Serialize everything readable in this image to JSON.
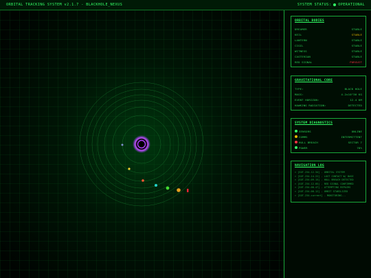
{
  "header": {
    "title": "ORBITAL TRACKING SYSTEM v2.1.7 - BLACKHOLE_NEXUS",
    "status_label": "SYSTEM STATUS:",
    "status_value": "OPERATIONAL"
  },
  "colors": {
    "accent": "#33ff66",
    "warn": "#e6b800",
    "alert": "#ff3344",
    "core": "#b040ff"
  },
  "orbital_bodies": {
    "title": "ORBITAL BODIES",
    "items": [
      {
        "name": "DREAMER",
        "status": "STABLE",
        "level": "ok"
      },
      {
        "name": "KEIL",
        "status": "STABLE",
        "level": "warn"
      },
      {
        "name": "LANTERN",
        "status": "STABLE",
        "level": "ok"
      },
      {
        "name": "CIGIL",
        "status": "STABLE",
        "level": "ok"
      },
      {
        "name": "WITNESS",
        "status": "STABLE",
        "level": "ok"
      },
      {
        "name": "CASTERIAN",
        "status": "STABLE",
        "level": "ok"
      },
      {
        "name": "RED SIGNAL",
        "status": "PURSUIT",
        "level": "bad"
      }
    ]
  },
  "gravitational_core": {
    "title": "GRAVITATIONAL CORE",
    "rows": [
      {
        "label": "TYPE:",
        "value": "BLACK HOLE"
      },
      {
        "label": "MASS:",
        "value": "4.2x10^36 KG"
      },
      {
        "label": "EVENT HORIZON:",
        "value": "12.4 KM"
      },
      {
        "label": "HAWKING RADIATION:",
        "value": "DETECTED"
      }
    ]
  },
  "system_diagnostics": {
    "title": "SYSTEM DIAGNOSTICS",
    "rows": [
      {
        "label": "SENSORS",
        "value": "ONLINE",
        "color": "#33ff66"
      },
      {
        "label": "COMMS",
        "value": "INTERMITTENT",
        "color": "#e6b800"
      },
      {
        "label": "HULL BREACH",
        "value": "SECTOR 7",
        "color": "#ff3344"
      },
      {
        "label": "POWER",
        "value": "78%",
        "color": "#33ff66"
      }
    ]
  },
  "navigation_log": {
    "title": "NAVIGATION LOG",
    "lines": [
      "> [SOT.234.12.34] - ORBITAL SYSTEM",
      "> [SOT.234.14.22] - LOST CONTACT W/ BASE",
      "> [SOT.234.09.15] - HULL BREACH DETECTED",
      "> [SOT.234.12.05] - RED SIGNAL CONFIRMED",
      "> [SOT.234.08.47] - ATTEMPTING REPAIRS",
      "> [SOT.234.08.12] - ORBIT STABILIZED",
      "> [SOT.234.current] - MONITORING..."
    ]
  },
  "orbit_bodies": [
    {
      "name": "dreamer",
      "color": "#7f8fd0"
    },
    {
      "name": "keil",
      "color": "#f2d030"
    },
    {
      "name": "lantern",
      "color": "#ff5533"
    },
    {
      "name": "cigil",
      "color": "#22d0c8"
    },
    {
      "name": "witness",
      "color": "#44dd33"
    },
    {
      "name": "casterian",
      "color": "#e6a020"
    },
    {
      "name": "red-signal",
      "color": "#ff2233"
    }
  ]
}
